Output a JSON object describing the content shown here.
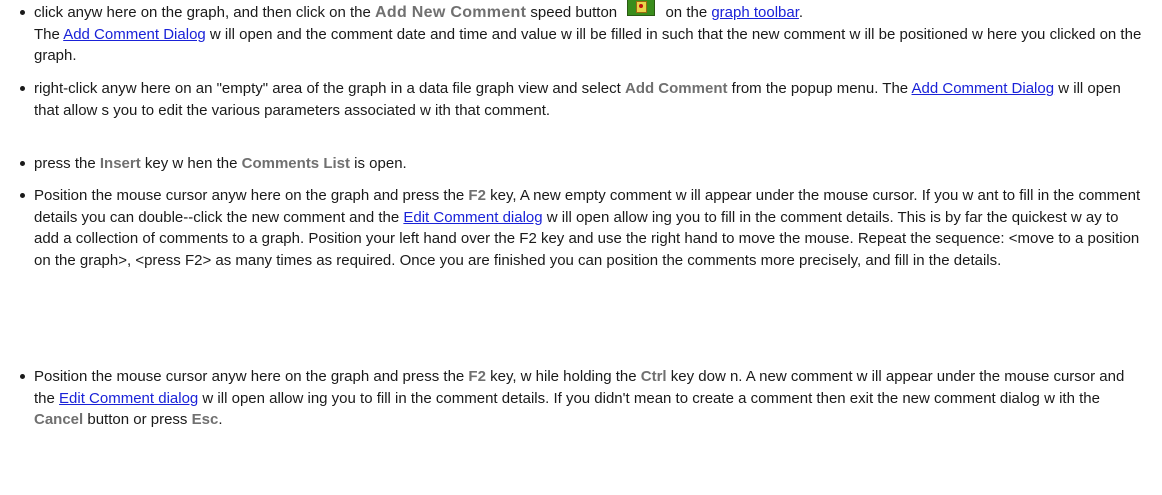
{
  "items": [
    {
      "p1": "click anyw here on the graph, and then click on the ",
      "k1": "Add New Comment",
      "p2": " speed button ",
      "p3": " on the ",
      "l1": "graph toolbar",
      "p4": ".",
      "p5": "The ",
      "l2": "Add Comment Dialog",
      "p6": " w ill open and the comment date and time and value w ill be filled in such that the new comment w ill be positioned w here you clicked on the graph."
    },
    {
      "p1": "right-click anyw here on an \"empty\" area of the graph in a data file graph view and select ",
      "k1": "Add Comment",
      "p2": " from the popup menu. The ",
      "l1": "Add Comment Dialog",
      "p3": " w ill open that allow s you to edit the various parameters associated w ith that comment."
    },
    {
      "p1": "press the ",
      "k1": "Insert",
      "p2": " key w hen the ",
      "k2": "Comments List",
      "p3": " is open."
    },
    {
      "p1": "Position the mouse cursor anyw here on the graph and press the ",
      "k1": "F2",
      "p2": " key,  A new  empty comment w ill appear under the mouse cursor.  If you w ant to fill in the comment details you  can double--click the new  comment and the ",
      "l1": "Edit Comment dialog",
      "p3": " w ill open allow ing you to fill in the comment details.  This is by far the quickest w ay to add a collection of comments to a graph.  Position your left hand over the F2 key and use the right hand to move the mouse.  Repeat the sequence: <move to a position on the graph>, <press F2> as many times as required.  Once you are finished you can position the comments more precisely, and fill in the details."
    },
    {
      "p1": "Position the mouse cursor anyw here on the graph and press the ",
      "k1": "F2",
      "p2": " key, w hile holding the ",
      "k2": "Ctrl",
      "p3": " key dow n.  A new comment w ill appear under the mouse cursor and the ",
      "l1": "Edit Comment dialog",
      "p4": " w ill open allow ing you to fill in the comment details.  If you didn't mean to create a comment then exit the new  comment dialog w ith the ",
      "k3": "Cancel",
      "p5": " button or press ",
      "k4": "Esc",
      "p6": "."
    }
  ],
  "icons": {
    "add_comment_button": "add-comment-icon"
  },
  "colors": {
    "link": "#1a22d8",
    "keyword": "#707070",
    "text": "#1a1a1a"
  }
}
